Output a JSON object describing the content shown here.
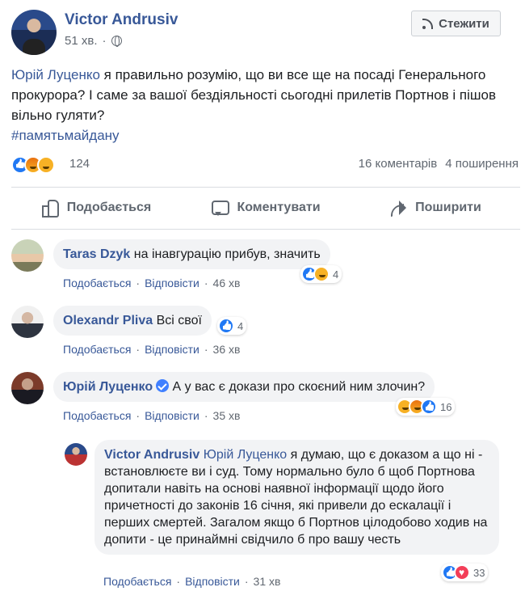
{
  "post": {
    "author": "Victor Andrusiv",
    "time": "51 хв.",
    "follow_label": "Стежити",
    "mention": "Юрій Луценко",
    "text": " я правильно розумію, що ви все ще на посаді Генерального прокурора? І саме за вашої бездіяльності сьогодні прилетів Портнов і пішов вільно гуляти?",
    "hashtag": "#памятьмайдану",
    "reaction_count": "124",
    "comments_count": "16 коментарів",
    "shares_count": "4 поширення"
  },
  "actions": {
    "like": "Подобається",
    "comment": "Коментувати",
    "share": "Поширити"
  },
  "comment_actions": {
    "like": "Подобається",
    "reply": "Відповісти",
    "sep": "·"
  },
  "comments": [
    {
      "name": "Taras Dzyk",
      "text": "на інавгурацію прибув, значить",
      "time": "46 хв",
      "reactions": "4"
    },
    {
      "name": "Olexandr Pliva",
      "text": "Всі свої",
      "time": "36 хв",
      "reactions": "4"
    },
    {
      "name": "Юрій Луценко",
      "text": "А у вас є докази про скоєний ним злочин?",
      "time": "35 хв",
      "reactions": "16"
    }
  ],
  "reply": {
    "name": "Victor Andrusiv",
    "mention": "Юрій Луценко",
    "text": " я думаю, що є доказом а що ні - встановлюєте ви і суд. Тому нормально було б щоб Портнова допитали навіть на основі наявної інформації щодо його причетності до законів 16 січня, які привели до ескалації і перших смертей. Загалом якщо б Портнов цілодобово ходив на допити - це принаймні свідчило б про вашу честь",
    "time": "31 хв",
    "reactions": "33"
  },
  "colors": {
    "link": "#385898",
    "bubble": "#f2f3f5",
    "meta": "#606770"
  }
}
